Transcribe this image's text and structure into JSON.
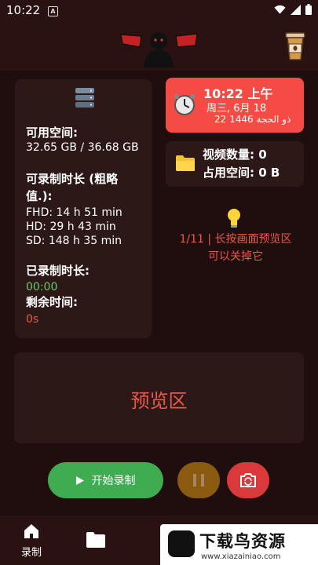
{
  "status_bar": {
    "time": "10:22",
    "notif_letter": "A"
  },
  "storage": {
    "free_space_label": "可用空间:",
    "free_space_value": "32.65 GB / 36.68 GB",
    "record_duration_label_1": "可录制时长 (粗略",
    "record_duration_label_2": "值.):",
    "fhd": "FHD: 14 h 51 min",
    "hd": "HD: 29 h 43 min",
    "sd": "SD: 148 h 35 min",
    "recorded_label": "已录制时长:",
    "recorded_value": "00:00",
    "remaining_label": "剩余时间:",
    "remaining_value": "0s"
  },
  "clock": {
    "time": "10:22 上午",
    "date": "周三, 6月 18",
    "hijri": "22 ذو الحجة 1446"
  },
  "videos": {
    "count_label": "视频数量: 0",
    "size_label": "占用空间: 0 B"
  },
  "tip": {
    "line1": "1/11 | 长按画面预览区",
    "line2": "可以关掉它"
  },
  "preview": {
    "label": "预览区"
  },
  "controls": {
    "start_label": "开始录制"
  },
  "nav": {
    "record_label": "录制"
  },
  "watermark": {
    "main": "下载鸟资源",
    "sub": "www.xiazainiao.com"
  },
  "colors": {
    "accent_red": "#f44c45",
    "start_green": "#3fac52",
    "pause_brown": "#8a5a10",
    "switch_red": "#d9393a"
  }
}
